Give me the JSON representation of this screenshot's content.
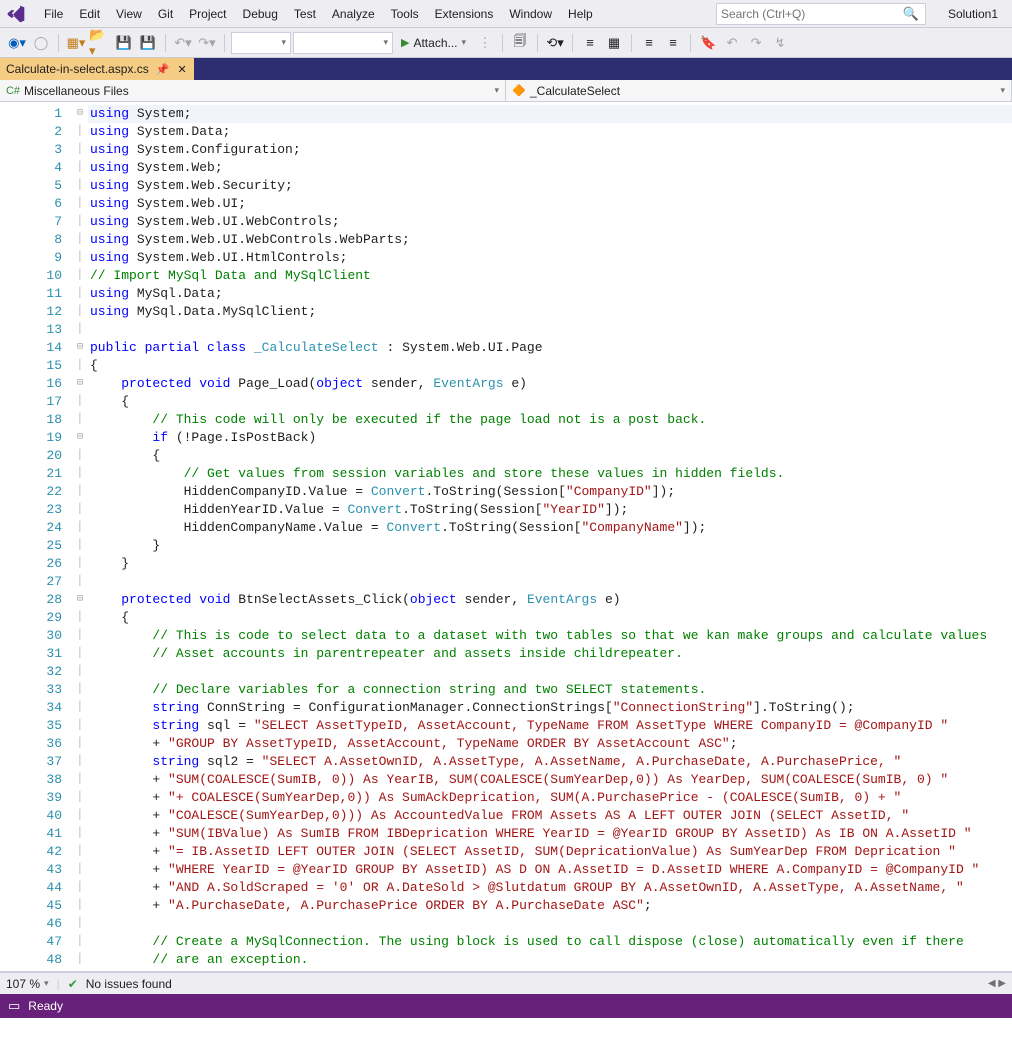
{
  "menu": {
    "items": [
      "File",
      "Edit",
      "View",
      "Git",
      "Project",
      "Debug",
      "Test",
      "Analyze",
      "Tools",
      "Extensions",
      "Window",
      "Help"
    ],
    "search_placeholder": "Search (Ctrl+Q)",
    "solution": "Solution1"
  },
  "toolbar": {
    "attach_label": "Attach..."
  },
  "tab": {
    "filename": "Calculate-in-select.aspx.cs"
  },
  "nav": {
    "scope": "Miscellaneous Files",
    "class": "_CalculateSelect"
  },
  "code": {
    "lines": [
      {
        "n": 1,
        "fold": "⊟",
        "seg": [
          [
            "kw",
            "using"
          ],
          [
            "",
            " System;"
          ]
        ]
      },
      {
        "n": 2,
        "seg": [
          [
            "kw",
            "using"
          ],
          [
            "",
            " System.Data;"
          ]
        ]
      },
      {
        "n": 3,
        "seg": [
          [
            "kw",
            "using"
          ],
          [
            "",
            " System.Configuration;"
          ]
        ]
      },
      {
        "n": 4,
        "seg": [
          [
            "kw",
            "using"
          ],
          [
            "",
            " System.Web;"
          ]
        ]
      },
      {
        "n": 5,
        "seg": [
          [
            "kw",
            "using"
          ],
          [
            "",
            " System.Web.Security;"
          ]
        ]
      },
      {
        "n": 6,
        "seg": [
          [
            "kw",
            "using"
          ],
          [
            "",
            " System.Web.UI;"
          ]
        ]
      },
      {
        "n": 7,
        "seg": [
          [
            "kw",
            "using"
          ],
          [
            "",
            " System.Web.UI.WebControls;"
          ]
        ]
      },
      {
        "n": 8,
        "seg": [
          [
            "kw",
            "using"
          ],
          [
            "",
            " System.Web.UI.WebControls.WebParts;"
          ]
        ]
      },
      {
        "n": 9,
        "seg": [
          [
            "kw",
            "using"
          ],
          [
            "",
            " System.Web.UI.HtmlControls;"
          ]
        ]
      },
      {
        "n": 10,
        "seg": [
          [
            "com",
            "// Import MySql Data and MySqlClient"
          ]
        ]
      },
      {
        "n": 11,
        "seg": [
          [
            "kw",
            "using"
          ],
          [
            "",
            " MySql.Data;"
          ]
        ]
      },
      {
        "n": 12,
        "seg": [
          [
            "kw",
            "using"
          ],
          [
            "",
            " MySql.Data.MySqlClient;"
          ]
        ]
      },
      {
        "n": 13,
        "seg": [
          [
            "",
            ""
          ]
        ]
      },
      {
        "n": 14,
        "fold": "⊟",
        "seg": [
          [
            "kw",
            "public"
          ],
          [
            "",
            " "
          ],
          [
            "kw",
            "partial"
          ],
          [
            "",
            " "
          ],
          [
            "kw",
            "class"
          ],
          [
            "",
            " "
          ],
          [
            "type",
            "_CalculateSelect"
          ],
          [
            "",
            " : System.Web.UI.Page"
          ]
        ]
      },
      {
        "n": 15,
        "seg": [
          [
            "",
            "{"
          ]
        ]
      },
      {
        "n": 16,
        "fold": "⊟",
        "seg": [
          [
            "",
            "    "
          ],
          [
            "kw",
            "protected"
          ],
          [
            "",
            " "
          ],
          [
            "kw",
            "void"
          ],
          [
            "",
            " Page_Load("
          ],
          [
            "kw",
            "object"
          ],
          [
            "",
            " sender, "
          ],
          [
            "type",
            "EventArgs"
          ],
          [
            "",
            " e)"
          ]
        ]
      },
      {
        "n": 17,
        "seg": [
          [
            "",
            "    {"
          ]
        ]
      },
      {
        "n": 18,
        "seg": [
          [
            "",
            "        "
          ],
          [
            "com",
            "// This code will only be executed if the page load not is a post back."
          ]
        ]
      },
      {
        "n": 19,
        "fold": "⊟",
        "seg": [
          [
            "",
            "        "
          ],
          [
            "kw",
            "if"
          ],
          [
            "",
            " (!Page.IsPostBack)"
          ]
        ]
      },
      {
        "n": 20,
        "seg": [
          [
            "",
            "        {"
          ]
        ]
      },
      {
        "n": 21,
        "seg": [
          [
            "",
            "            "
          ],
          [
            "com",
            "// Get values from session variables and store these values in hidden fields."
          ]
        ]
      },
      {
        "n": 22,
        "seg": [
          [
            "",
            "            HiddenCompanyID.Value = "
          ],
          [
            "type",
            "Convert"
          ],
          [
            "",
            ".ToString(Session["
          ],
          [
            "str",
            "\"CompanyID\""
          ],
          [
            "",
            "]);"
          ]
        ]
      },
      {
        "n": 23,
        "seg": [
          [
            "",
            "            HiddenYearID.Value = "
          ],
          [
            "type",
            "Convert"
          ],
          [
            "",
            ".ToString(Session["
          ],
          [
            "str",
            "\"YearID\""
          ],
          [
            "",
            "]);"
          ]
        ]
      },
      {
        "n": 24,
        "seg": [
          [
            "",
            "            HiddenCompanyName.Value = "
          ],
          [
            "type",
            "Convert"
          ],
          [
            "",
            ".ToString(Session["
          ],
          [
            "str",
            "\"CompanyName\""
          ],
          [
            "",
            "]);"
          ]
        ]
      },
      {
        "n": 25,
        "seg": [
          [
            "",
            "        }"
          ]
        ]
      },
      {
        "n": 26,
        "seg": [
          [
            "",
            "    }"
          ]
        ]
      },
      {
        "n": 27,
        "seg": [
          [
            "",
            ""
          ]
        ]
      },
      {
        "n": 28,
        "fold": "⊟",
        "seg": [
          [
            "",
            "    "
          ],
          [
            "kw",
            "protected"
          ],
          [
            "",
            " "
          ],
          [
            "kw",
            "void"
          ],
          [
            "",
            " BtnSelectAssets_Click("
          ],
          [
            "kw",
            "object"
          ],
          [
            "",
            " sender, "
          ],
          [
            "type",
            "EventArgs"
          ],
          [
            "",
            " e)"
          ]
        ]
      },
      {
        "n": 29,
        "seg": [
          [
            "",
            "    {"
          ]
        ]
      },
      {
        "n": 30,
        "seg": [
          [
            "",
            "        "
          ],
          [
            "com",
            "// This is code to select data to a dataset with two tables so that we kan make groups and calculate values"
          ]
        ]
      },
      {
        "n": 31,
        "seg": [
          [
            "",
            "        "
          ],
          [
            "com",
            "// Asset accounts in parentrepeater and assets inside childrepeater."
          ]
        ]
      },
      {
        "n": 32,
        "seg": [
          [
            "",
            ""
          ]
        ]
      },
      {
        "n": 33,
        "seg": [
          [
            "",
            "        "
          ],
          [
            "com",
            "// Declare variables for a connection string and two SELECT statements."
          ]
        ]
      },
      {
        "n": 34,
        "seg": [
          [
            "",
            "        "
          ],
          [
            "kw",
            "string"
          ],
          [
            "",
            " ConnString = ConfigurationManager.ConnectionStrings["
          ],
          [
            "str",
            "\"ConnectionString\""
          ],
          [
            "",
            "].ToString();"
          ]
        ]
      },
      {
        "n": 35,
        "seg": [
          [
            "",
            "        "
          ],
          [
            "kw",
            "string"
          ],
          [
            "",
            " sql = "
          ],
          [
            "str",
            "\"SELECT AssetTypeID, AssetAccount, TypeName FROM AssetType WHERE CompanyID = @CompanyID \""
          ]
        ]
      },
      {
        "n": 36,
        "seg": [
          [
            "",
            "        + "
          ],
          [
            "str",
            "\"GROUP BY AssetTypeID, AssetAccount, TypeName ORDER BY AssetAccount ASC\""
          ],
          [
            "",
            ";"
          ]
        ]
      },
      {
        "n": 37,
        "seg": [
          [
            "",
            "        "
          ],
          [
            "kw",
            "string"
          ],
          [
            "",
            " sql2 = "
          ],
          [
            "str",
            "\"SELECT A.AssetOwnID, A.AssetType, A.AssetName, A.PurchaseDate, A.PurchasePrice, \""
          ]
        ]
      },
      {
        "n": 38,
        "seg": [
          [
            "",
            "        + "
          ],
          [
            "str",
            "\"SUM(COALESCE(SumIB, 0)) As YearIB, SUM(COALESCE(SumYearDep,0)) As YearDep, SUM(COALESCE(SumIB, 0) \""
          ]
        ]
      },
      {
        "n": 39,
        "seg": [
          [
            "",
            "        + "
          ],
          [
            "str",
            "\"+ COALESCE(SumYearDep,0)) As SumAckDeprication, SUM(A.PurchasePrice - (COALESCE(SumIB, 0) + \""
          ]
        ]
      },
      {
        "n": 40,
        "seg": [
          [
            "",
            "        + "
          ],
          [
            "str",
            "\"COALESCE(SumYearDep,0))) As AccountedValue FROM Assets AS A LEFT OUTER JOIN (SELECT AssetID, \""
          ]
        ]
      },
      {
        "n": 41,
        "seg": [
          [
            "",
            "        + "
          ],
          [
            "str",
            "\"SUM(IBValue) As SumIB FROM IBDeprication WHERE YearID = @YearID GROUP BY AssetID) As IB ON A.AssetID \""
          ]
        ]
      },
      {
        "n": 42,
        "seg": [
          [
            "",
            "        + "
          ],
          [
            "str",
            "\"= IB.AssetID LEFT OUTER JOIN (SELECT AssetID, SUM(DepricationValue) As SumYearDep FROM Deprication \""
          ]
        ]
      },
      {
        "n": 43,
        "seg": [
          [
            "",
            "        + "
          ],
          [
            "str",
            "\"WHERE YearID = @YearID GROUP BY AssetID) AS D ON A.AssetID = D.AssetID WHERE A.CompanyID = @CompanyID \""
          ]
        ]
      },
      {
        "n": 44,
        "seg": [
          [
            "",
            "        + "
          ],
          [
            "str",
            "\"AND A.SoldScraped = '0' OR A.DateSold > @Slutdatum GROUP BY A.AssetOwnID, A.AssetType, A.AssetName, \""
          ]
        ]
      },
      {
        "n": 45,
        "seg": [
          [
            "",
            "        + "
          ],
          [
            "str",
            "\"A.PurchaseDate, A.PurchasePrice ORDER BY A.PurchaseDate ASC\""
          ],
          [
            "",
            ";"
          ]
        ]
      },
      {
        "n": 46,
        "seg": [
          [
            "",
            ""
          ]
        ]
      },
      {
        "n": 47,
        "seg": [
          [
            "",
            "        "
          ],
          [
            "com",
            "// Create a MySqlConnection. The using block is used to call dispose (close) automatically even if there"
          ]
        ]
      },
      {
        "n": 48,
        "seg": [
          [
            "",
            "        "
          ],
          [
            "com",
            "// are an exception."
          ]
        ]
      }
    ]
  },
  "zoombar": {
    "zoom": "107 %",
    "issues": "No issues found"
  },
  "status": {
    "ready": "Ready"
  }
}
